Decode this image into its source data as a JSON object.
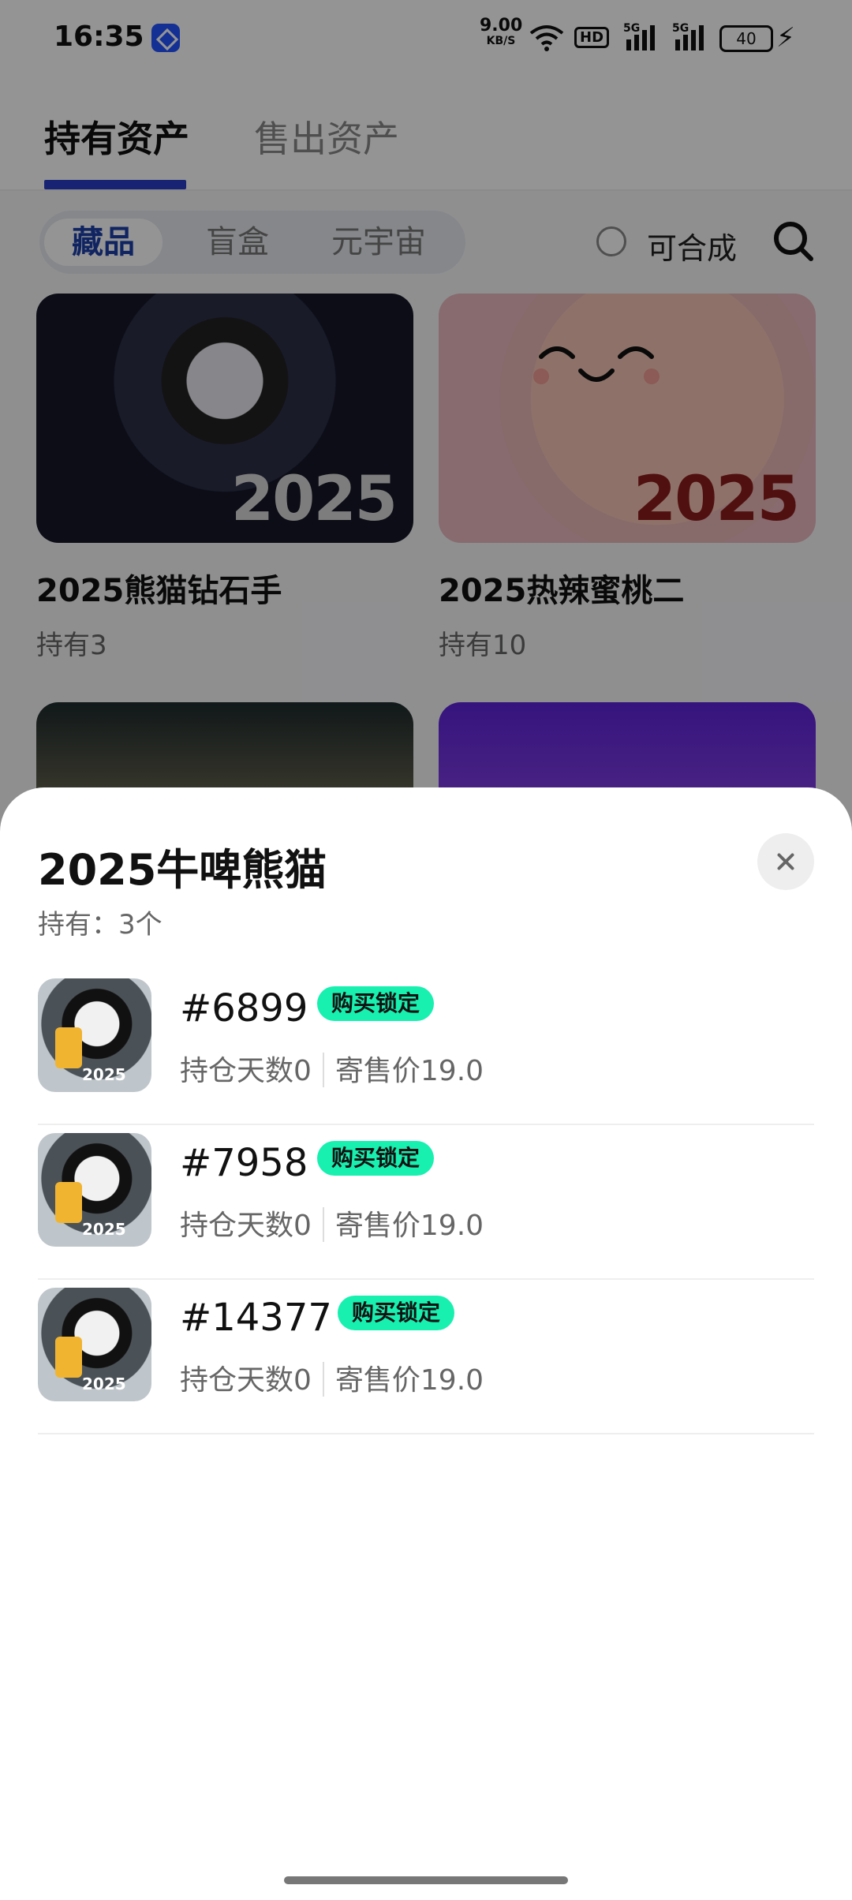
{
  "status": {
    "time": "16:35",
    "net_speed": "9.00",
    "net_unit": "KB/S",
    "hd": "HD",
    "sig1": "5G",
    "sig2": "5G",
    "battery": "40"
  },
  "tabs": [
    {
      "label": "持有资产",
      "active": true
    },
    {
      "label": "售出资产",
      "active": false
    }
  ],
  "filters": {
    "segments": [
      {
        "label": "藏品",
        "active": true
      },
      {
        "label": "盲盒",
        "active": false
      },
      {
        "label": "元宇宙",
        "active": false
      }
    ],
    "checkbox_label": "可合成"
  },
  "collections": [
    {
      "title": "2025熊猫钻石手",
      "count": "持有3",
      "year": "2025"
    },
    {
      "title": "2025热辣蜜桃二",
      "count": "持有10",
      "year": "2025"
    }
  ],
  "sheet": {
    "title": "2025牛啤熊猫",
    "subtitle": "持有：3个",
    "items": [
      {
        "id": "#6899",
        "badge": "购买锁定",
        "days": "持仓天数0",
        "price": "寄售价19.0"
      },
      {
        "id": "#7958",
        "badge": "购买锁定",
        "days": "持仓天数0",
        "price": "寄售价19.0"
      },
      {
        "id": "#14377",
        "badge": "购买锁定",
        "days": "持仓天数0",
        "price": "寄售价19.0"
      }
    ]
  },
  "colors": {
    "accent": "#2a3ec6",
    "badge": "#18f0b0"
  }
}
